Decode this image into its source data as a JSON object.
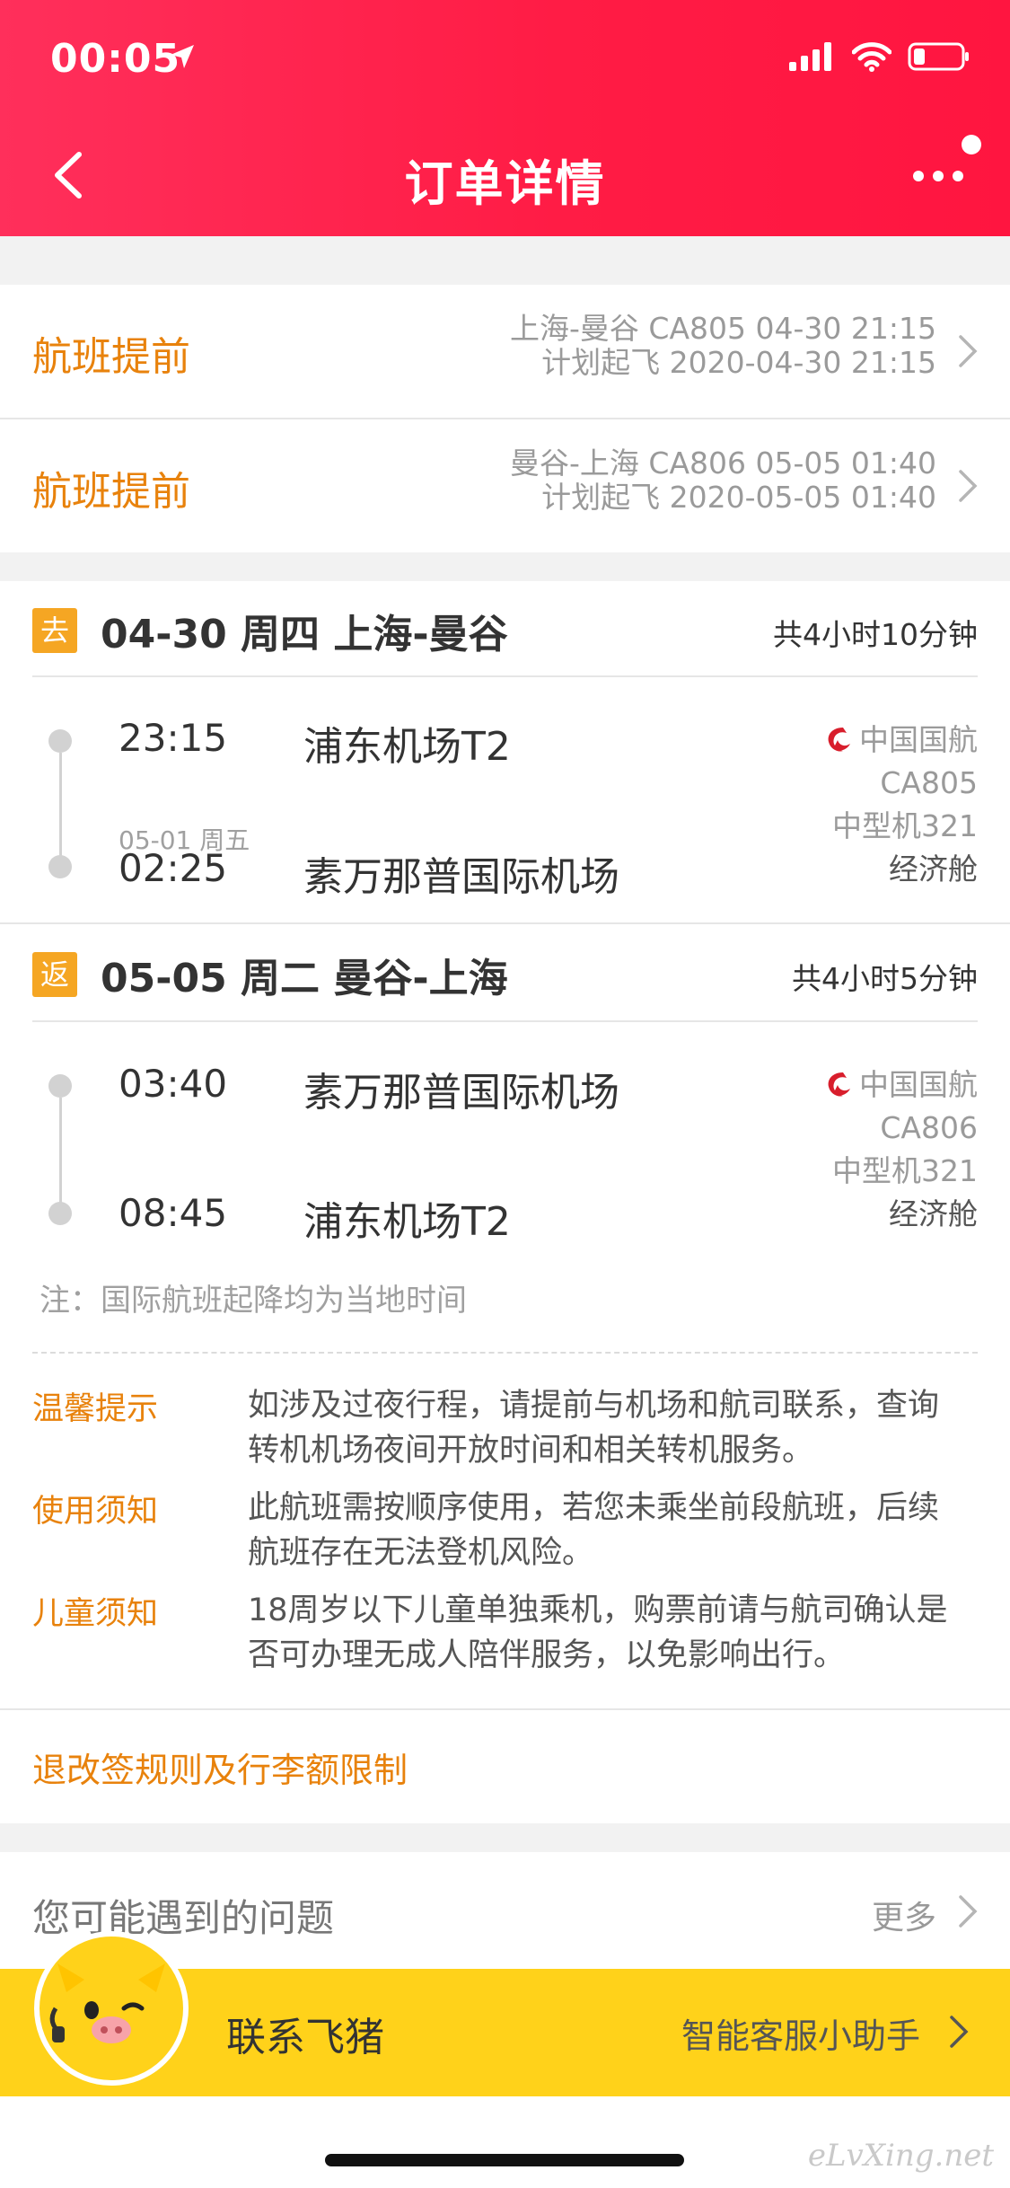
{
  "status": {
    "time": "00:05"
  },
  "header": {
    "title": "订单详情"
  },
  "alerts": [
    {
      "label": "航班提前",
      "line1": "上海-曼谷 CA805 04-30 21:15",
      "line2": "计划起飞 2020-04-30 21:15"
    },
    {
      "label": "航班提前",
      "line1": "曼谷-上海 CA806 05-05 01:40",
      "line2": "计划起飞 2020-05-05 01:40"
    }
  ],
  "legs": [
    {
      "tag": "去",
      "title": "04-30 周四 上海-曼谷",
      "duration": "共4小时10分钟",
      "dep_time": "23:15",
      "dep_airport": "浦东机场T2",
      "arr_date": "05-01 周五",
      "arr_time": "02:25",
      "arr_airport": "素万那普国际机场",
      "airline": "中国国航",
      "flight_no": "CA805",
      "aircraft": "中型机321",
      "cabin": "经济舱"
    },
    {
      "tag": "返",
      "title": "05-05 周二 曼谷-上海",
      "duration": "共4小时5分钟",
      "dep_time": "03:40",
      "dep_airport": "素万那普国际机场",
      "arr_time": "08:45",
      "arr_airport": "浦东机场T2",
      "airline": "中国国航",
      "flight_no": "CA806",
      "aircraft": "中型机321",
      "cabin": "经济舱"
    }
  ],
  "note": "注：国际航班起降均为当地时间",
  "tips": [
    {
      "key": "温馨提示",
      "value": "如涉及过夜行程，请提前与机场和航司联系，查询转机机场夜间开放时间和相关转机服务。"
    },
    {
      "key": "使用须知",
      "value": "此航班需按顺序使用，若您未乘坐前段航班，后续航班存在无法登机风险。"
    },
    {
      "key": "儿童须知",
      "value": "18周岁以下儿童单独乘机，购票前请与航司确认是否可办理无成人陪伴服务，以免影响出行。"
    }
  ],
  "rules_link": "退改签规则及行李额限制",
  "faq": {
    "title": "您可能遇到的问题",
    "more": "更多"
  },
  "contact": {
    "label": "联系飞猪",
    "assistant": "智能客服小助手"
  },
  "watermark": "eLvXing.net",
  "colors": {
    "header": "#ff1c45",
    "accent_orange": "#e8820c",
    "tag": "#f5a623",
    "contact_bar": "#ffd21a",
    "airline_red": "#d81e2c"
  }
}
